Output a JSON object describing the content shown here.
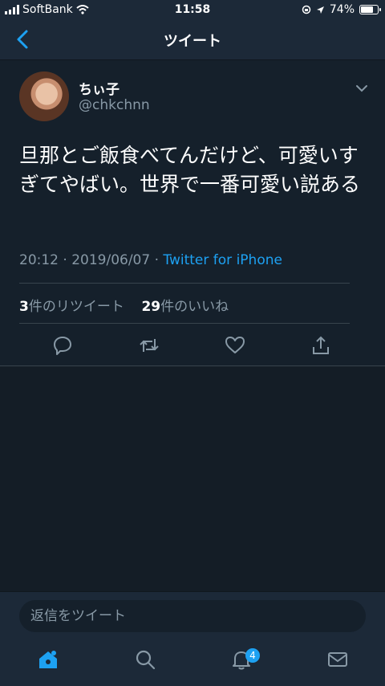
{
  "status": {
    "carrier": "SoftBank",
    "time": "11:58",
    "battery": "74%"
  },
  "nav": {
    "title": "ツイート"
  },
  "tweet": {
    "name": "ちぃ子",
    "handle": "@chkchnn",
    "text": "旦那とご飯食べてんだけど、可愛いすぎてやばい。世界で一番可愛い説ある",
    "timestamp": "20:12 · 2019/06/07 · ",
    "source": "Twitter for iPhone",
    "retweet_count": "3",
    "retweet_label": "件のリツイート",
    "like_count": "29",
    "like_label": "件のいいね"
  },
  "compose": {
    "placeholder": "返信をツイート"
  },
  "tabs": {
    "notifications_badge": "4"
  },
  "colors": {
    "background": "#15202b",
    "accent": "#1da1f2",
    "muted": "#8899a6"
  }
}
